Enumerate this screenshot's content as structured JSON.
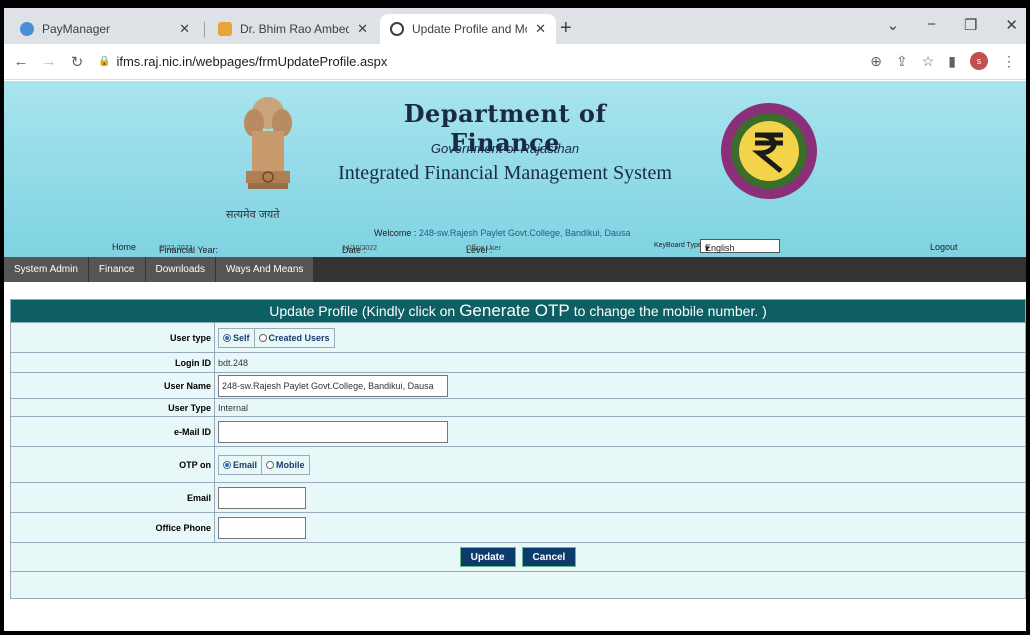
{
  "browser": {
    "tabs": [
      {
        "title": "PayManager",
        "color": "#4a90d9"
      },
      {
        "title": "Dr. Bhim Rao Ambedkar Governm",
        "color": "#e7a43a"
      },
      {
        "title": "Update Profile and Mobile Numb",
        "color": "#202124"
      }
    ],
    "new_tab": "+",
    "url": "ifms.raj.nic.in/webpages/frmUpdateProfile.aspx",
    "profile_initial": "s"
  },
  "header": {
    "title": "Department of Finance",
    "subtitle": "Government of Rajasthan",
    "system": "Integrated Financial Management System",
    "motto": "सत्यमेव जयते",
    "welcome_label": "Welcome :",
    "welcome_value": "248-sw.Rajesh Paylet Govt.College, Bandikui, Dausa",
    "home": "Home",
    "fy_label": "Financial Year:",
    "fy_value": "2022-2023",
    "date_label": "Date :",
    "date_value": "14/10/2022",
    "level_label": "Level :",
    "level_value": "Office User",
    "kb_label": "KeyBoard Type:",
    "kb_value": "English",
    "logout": "Logout"
  },
  "menu": [
    "System Admin",
    "Finance",
    "Downloads",
    "Ways And Means"
  ],
  "form": {
    "title_pre": "Update Profile (Kindly click on",
    "title_big": "Generate OTP",
    "title_post": "to change the mobile number. )",
    "user_type_label": "User type",
    "user_type_options": [
      "Self",
      "Created Users"
    ],
    "login_id_label": "Login ID",
    "login_id_value": "bdt.248",
    "user_name_label": "User Name",
    "user_name_value": "248-sw.Rajesh Paylet Govt.College, Bandikui, Dausa",
    "user_type2_label": "User Type",
    "user_type2_value": "Internal",
    "email_id_label": "e-Mail ID",
    "email_id_value": "",
    "otp_label": "OTP on",
    "otp_options": [
      "Email",
      "Mobile"
    ],
    "email_label": "Email",
    "email_value": "",
    "office_phone_label": "Office Phone",
    "office_phone_value": "",
    "update_btn": "Update",
    "cancel_btn": "Cancel"
  }
}
